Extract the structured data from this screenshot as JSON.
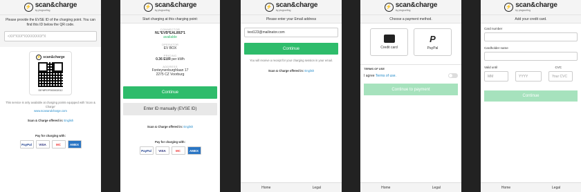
{
  "brand": {
    "name": "scan&charge",
    "sub": "by plugsurfing"
  },
  "s1": {
    "instruction": "Please provide the EVSE ID of the charging point. You can find this ID below the QR code.",
    "placeholder": "<XX*XXX*XXXXXXXX*X",
    "sticker_id": "DE*8PS*P000002012",
    "note": "This service is only available at charging points equipped with 'Scan & Charge'",
    "url": "www.scanandcharge.com",
    "offered": "Scan & Charge offered in:",
    "lang": "English",
    "pay_title": "Pay for charging with:",
    "cards": [
      "PayPal",
      "VISA",
      "MC",
      "AMEX"
    ]
  },
  "s2": {
    "title": "Start charging at this charging point:",
    "connector_label": "CONNECTOR",
    "connector": "NL*EVB*EAL892*1",
    "status": "available",
    "operator_label": "OPERATOR",
    "operator": "EV BOX",
    "pricing_label": "PRICING",
    "price": "0.36 EUR",
    "price_unit": "per kWh",
    "address_label": "ADDRESS",
    "address1": "Fonteynenburghlaan 17",
    "address2": "2275 CZ Voorburg",
    "continue": "Continue",
    "manual": "Enter ID manually (EVSE ID)",
    "offered": "Scan & Charge offered in:",
    "lang": "English",
    "pay_title": "Pay for charging with:",
    "cards": [
      "PayPal",
      "VISA",
      "MC",
      "AMEX"
    ]
  },
  "s3": {
    "title": "Please enter your Email address",
    "email": "test123@mailinator.com",
    "continue": "Continue",
    "note": "You will receive a receipt for your charging session in your email.",
    "offered": "Scan & Charge offered in:",
    "lang": "English",
    "home": "Home",
    "legal": "Legal"
  },
  "s4": {
    "title": "Choose a payment method.",
    "credit": "Credit card",
    "paypal": "PayPal",
    "terms_title": "TERMS OF USE",
    "agree": "I agree",
    "terms_link": "Terms of use.",
    "continue": "Continue to payment",
    "home": "Home",
    "legal": "Legal"
  },
  "s5": {
    "title": "Add your credit card.",
    "card_number": "Card number",
    "holder": "Cardholder name",
    "valid": "Valid until",
    "cvc": "CVC",
    "mm": "MM",
    "yyyy": "YYYY",
    "cvc_ph": "Your CVC",
    "continue": "Continue",
    "home": "Home",
    "legal": "Legal"
  }
}
